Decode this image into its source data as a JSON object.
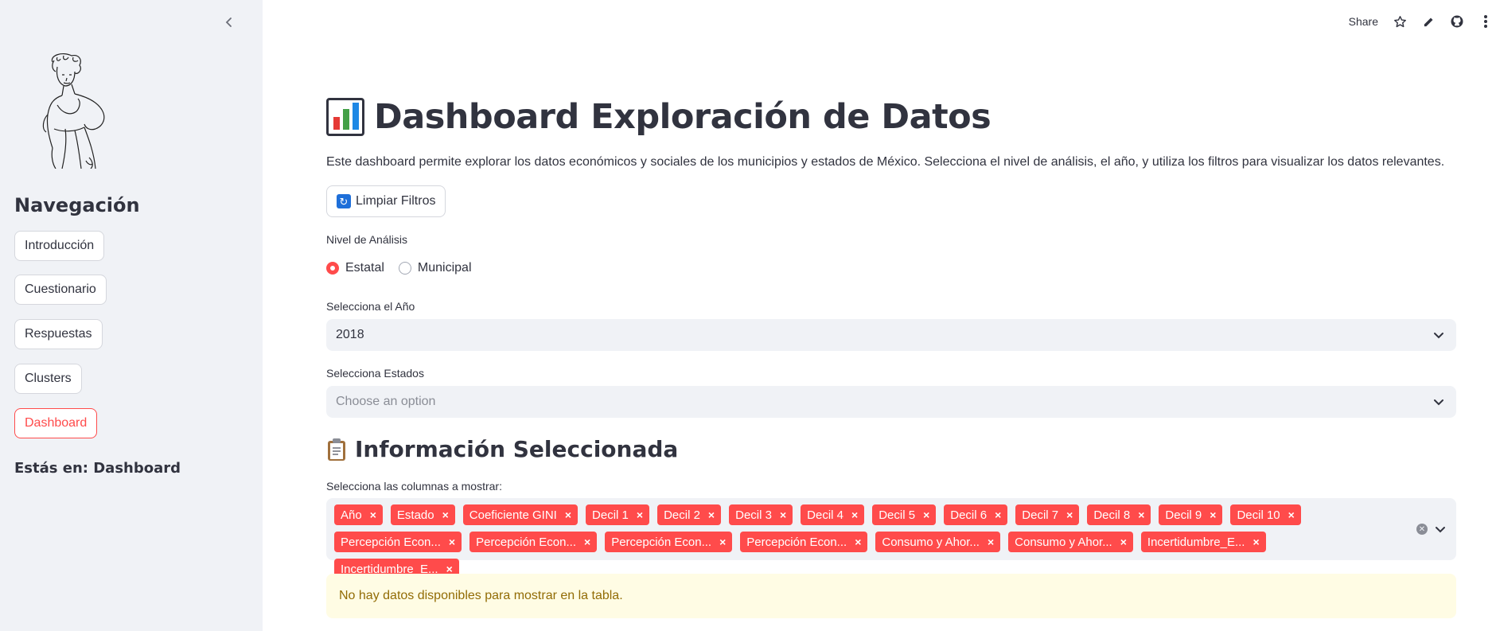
{
  "sidebar": {
    "nav_title": "Navegación",
    "items": [
      {
        "label": "Introducción",
        "active": false
      },
      {
        "label": "Cuestionario",
        "active": false
      },
      {
        "label": "Respuestas",
        "active": false
      },
      {
        "label": "Clusters",
        "active": false
      },
      {
        "label": "Dashboard",
        "active": true
      }
    ],
    "location_text": "Estás en: Dashboard"
  },
  "topbar": {
    "share_label": "Share",
    "icons": [
      "star-icon",
      "pencil-icon",
      "github-icon",
      "more-vertical-icon"
    ]
  },
  "main": {
    "title": "Dashboard Exploración de Datos",
    "title_icon": "bar-chart-emoji",
    "description": "Este dashboard permite explorar los datos económicos y sociales de los municipios y estados de México. Selecciona el nivel de análisis, el año, y utiliza los filtros para visualizar los datos relevantes.",
    "clear_filters_label": "Limpiar Filtros",
    "analysis_level": {
      "label": "Nivel de Análisis",
      "options": [
        "Estatal",
        "Municipal"
      ],
      "selected": "Estatal"
    },
    "year": {
      "label": "Selecciona el Año",
      "value": "2018"
    },
    "states": {
      "label": "Selecciona Estados",
      "placeholder": "Choose an option"
    },
    "section_title": "Información Seleccionada",
    "section_icon": "clipboard-emoji",
    "columns": {
      "label": "Selecciona las columnas a mostrar:",
      "tags": [
        "Año",
        "Estado",
        "Coeficiente GINI",
        "Decil 1",
        "Decil 2",
        "Decil 3",
        "Decil 4",
        "Decil 5",
        "Decil 6",
        "Decil 7",
        "Decil 8",
        "Decil 9",
        "Decil 10",
        "Percepción Econ...",
        "Percepción Econ...",
        "Percepción Econ...",
        "Percepción Econ...",
        "Consumo y Ahor...",
        "Consumo y Ahor...",
        "Incertidumbre_E...",
        "Incertidumbre_E..."
      ]
    },
    "alert_text": "No hay datos disponibles para mostrar en la tabla."
  },
  "colors": {
    "accent": "#FF4B4B",
    "sidebar_bg": "#F0F2F6",
    "alert_bg": "#FFFCE4",
    "alert_text": "#926C05"
  }
}
